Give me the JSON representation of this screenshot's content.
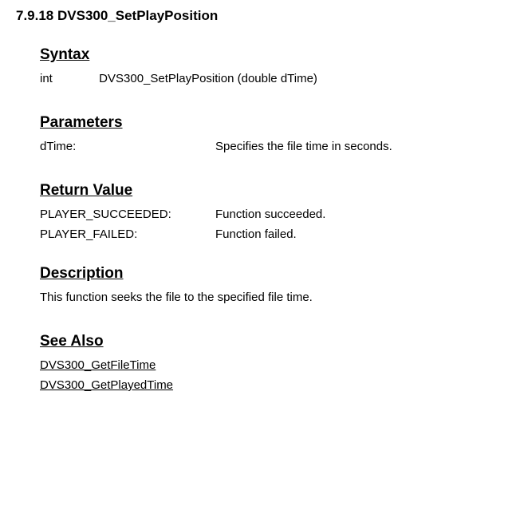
{
  "title": "7.9.18 DVS300_SetPlayPosition",
  "syntax": {
    "heading": "Syntax",
    "returnType": "int",
    "signature": "DVS300_SetPlayPosition (double dTime)"
  },
  "parameters": {
    "heading": "Parameters",
    "items": [
      {
        "name": "dTime:",
        "description": "Specifies the file time in seconds."
      }
    ]
  },
  "returnValue": {
    "heading": "Return Value",
    "items": [
      {
        "label": "PLAYER_SUCCEEDED:",
        "description": "Function succeeded."
      },
      {
        "label": "PLAYER_FAILED:",
        "description": "Function failed."
      }
    ]
  },
  "description": {
    "heading": "Description",
    "text": "This function seeks the file to the specified file time."
  },
  "seeAlso": {
    "heading": "See Also",
    "links": [
      "DVS300_GetFileTime",
      "DVS300_GetPlayedTime"
    ]
  }
}
